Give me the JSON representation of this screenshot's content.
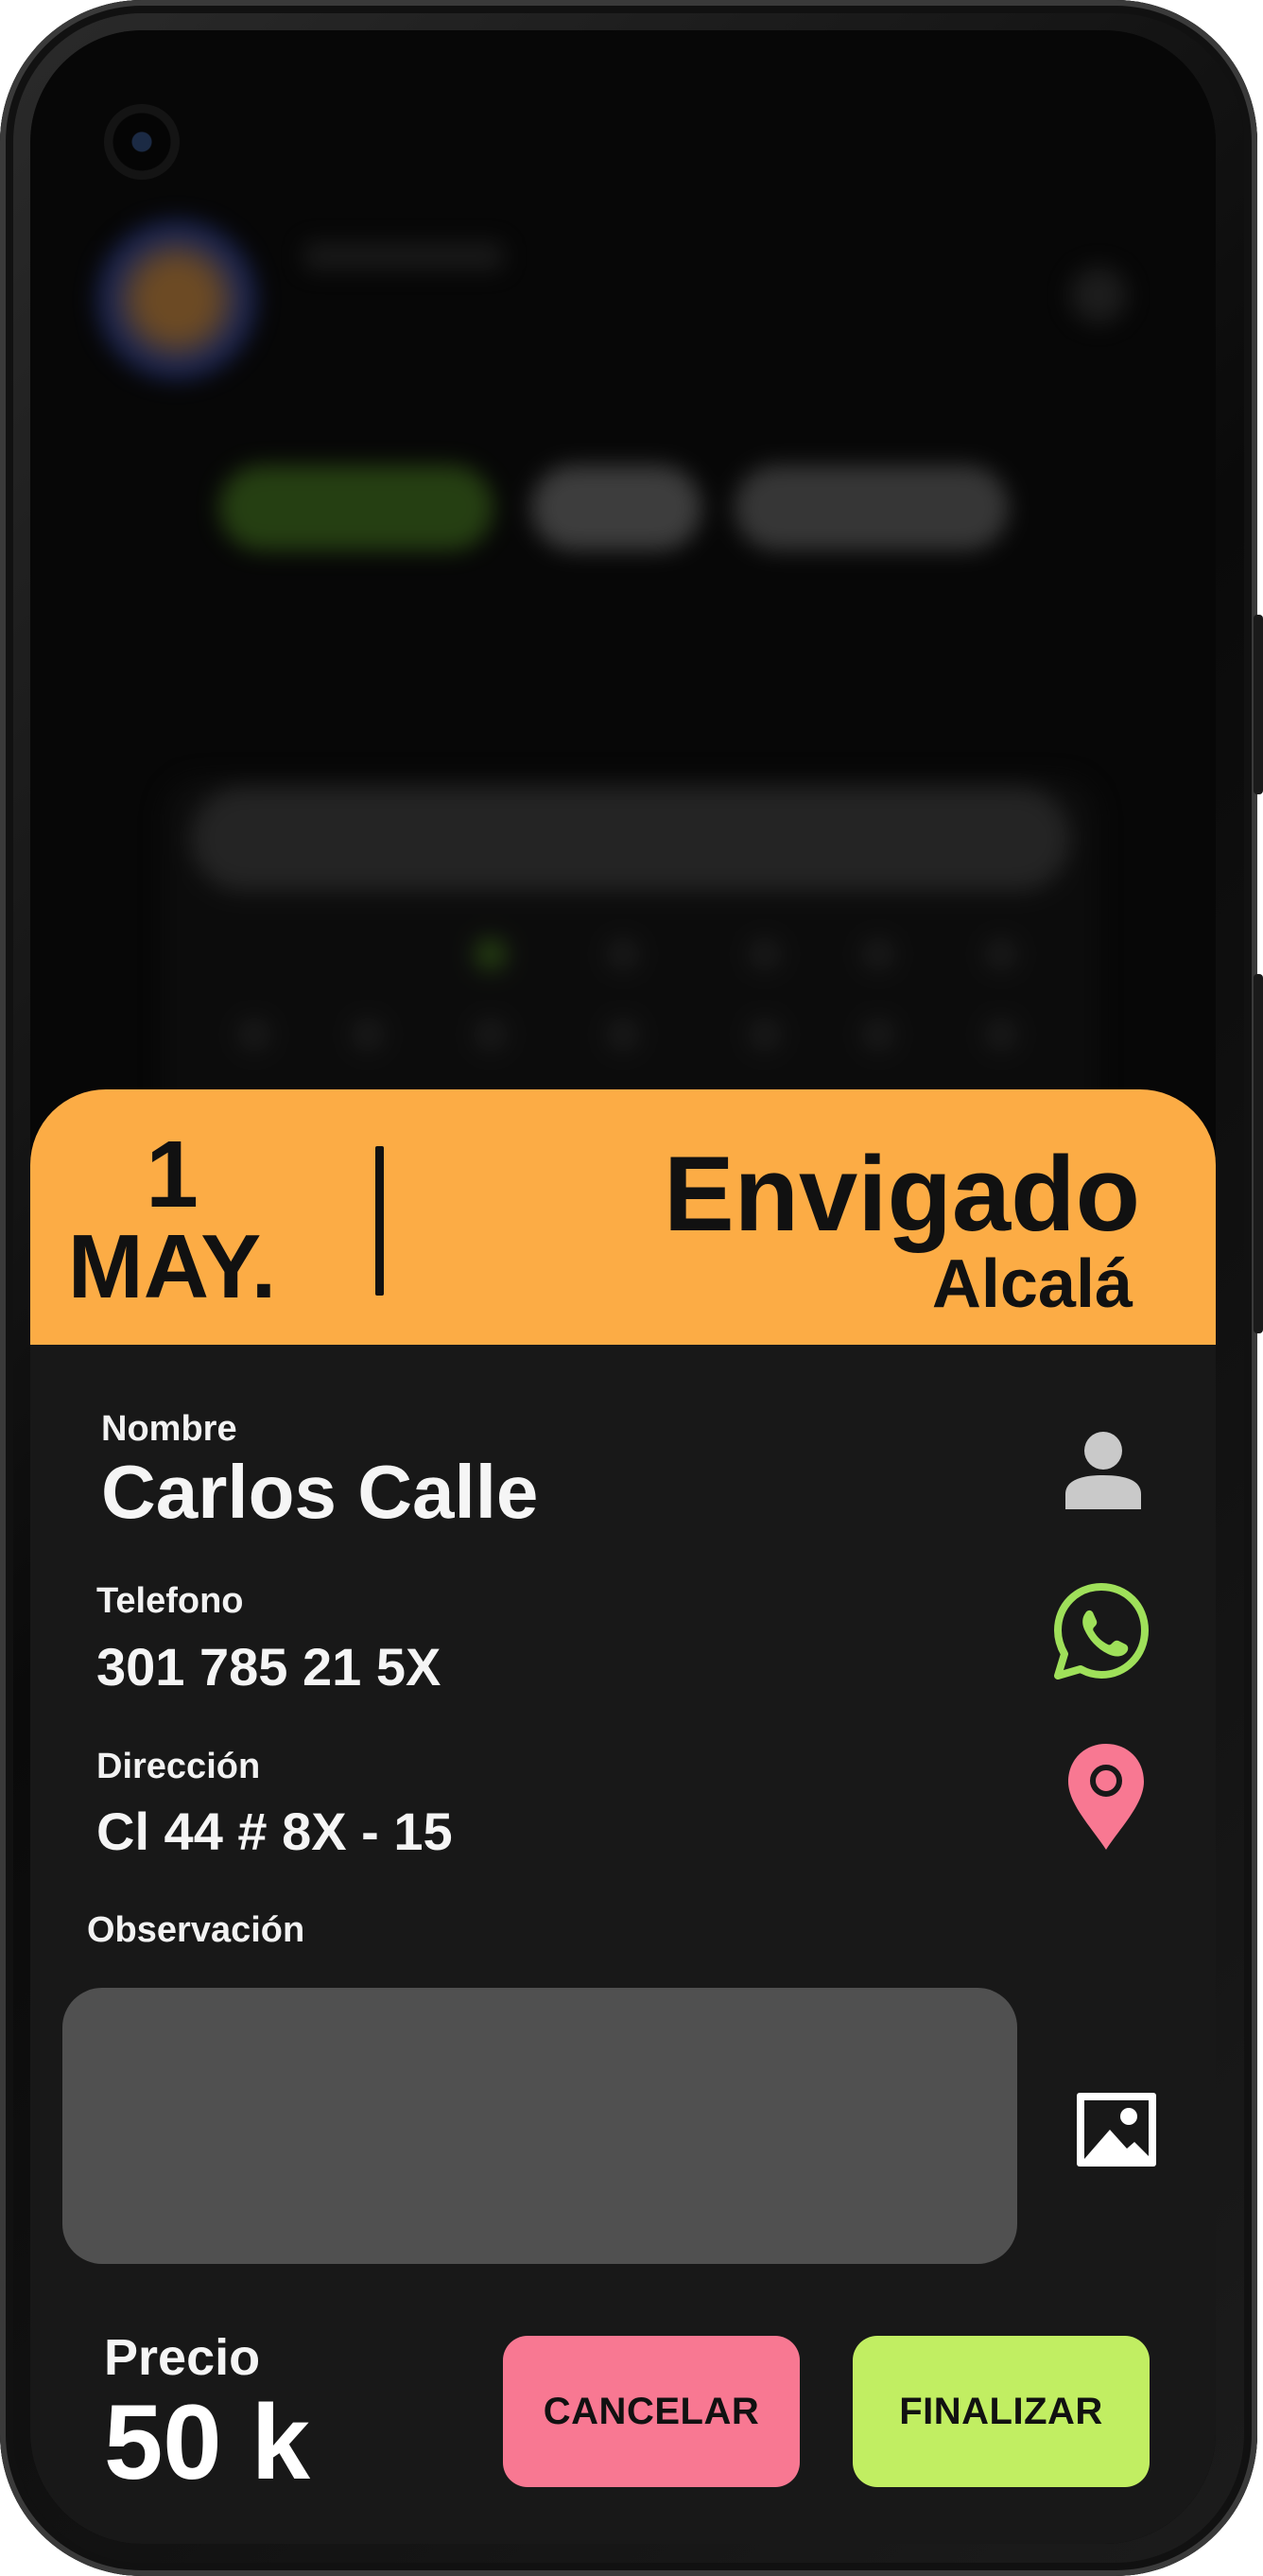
{
  "sheet": {
    "date_day": "1",
    "date_month": "MAY.",
    "city": "Envigado",
    "district": "Alcalá",
    "header_color": "#fcac45"
  },
  "customer": {
    "name_label": "Nombre",
    "name": "Carlos Calle",
    "phone_label": "Telefono",
    "phone": "301 785 21 5X",
    "address_label": "Dirección",
    "address": "Cl 44 # 8X - 15",
    "notes_label": "Observación",
    "notes_value": ""
  },
  "price": {
    "label": "Precio",
    "value": "50 k"
  },
  "actions": {
    "cancel_label": "CANCELAR",
    "cancel_color": "#f87892",
    "finish_label": "FINALIZAR",
    "finish_color": "#c1ee62"
  },
  "icons": {
    "name": "person-icon",
    "phone": "whatsapp-icon",
    "address": "map-pin-icon",
    "notes": "image-icon"
  },
  "colors": {
    "whatsapp": "#9fe05a",
    "pin": "#f87892",
    "background": "#181818",
    "notes_box": "#505050"
  }
}
